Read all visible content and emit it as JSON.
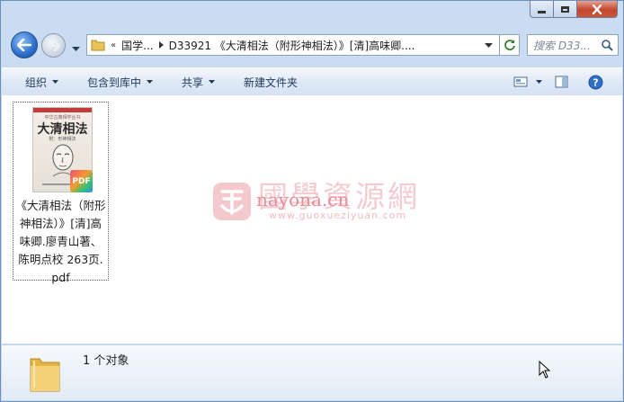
{
  "address": {
    "crumbs": [
      "国学...",
      "D33921 《大清相法（附形神相法）》[清]高味卿...."
    ],
    "overflow_marker": "«"
  },
  "search": {
    "placeholder": "搜索 D33..."
  },
  "toolbar": {
    "organize": "组织",
    "include_library": "包含到库中",
    "share": "共享",
    "new_folder": "新建文件夹"
  },
  "file": {
    "name_lines": [
      "《大清相法（附形",
      "神相法）》[清]高",
      "味卿.廖青山著、",
      "陈明点校 263页.",
      "pdf"
    ],
    "thumbnail_title": "大清相法",
    "thumbnail_top": "中华古典相学丛书",
    "thumbnail_sub": "附：形神相法",
    "badge_text": "PDF"
  },
  "watermark": {
    "cn": "國學資源網",
    "url": "nayona.cn",
    "sub": "www.guoxueziyuan.com"
  },
  "status": {
    "count_text": "1 个对象"
  },
  "colors": {
    "accent": "#2a6ecb",
    "close": "#c4462c",
    "toolbar_text": "#1e395b"
  },
  "icons": [
    "back-arrow-icon",
    "forward-arrow-icon",
    "folder-icon",
    "refresh-icon",
    "search-icon",
    "view-icon",
    "preview-pane-icon",
    "help-icon"
  ]
}
